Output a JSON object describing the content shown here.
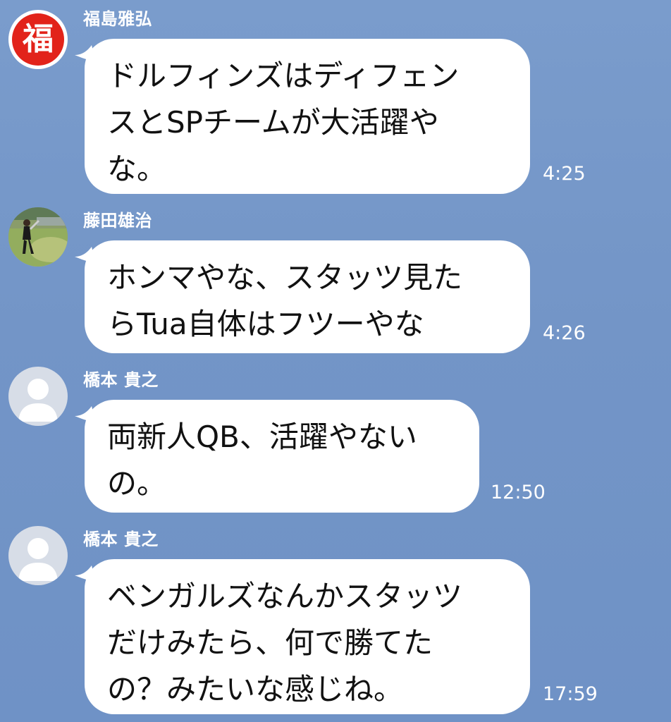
{
  "messages": [
    {
      "sender": "福島雅弘",
      "avatar": "fuku-logo-icon",
      "avatar_text": "福",
      "lines": [
        "ドルフィンズはディフェン",
        "スとSPチームが大活躍や",
        "な。"
      ],
      "time": "4:25"
    },
    {
      "sender": "藤田雄治",
      "avatar": "golfer-photo-icon",
      "lines": [
        "ホンマやな、スタッツ見た",
        "らTua自体はフツーやな"
      ],
      "time": "4:26"
    },
    {
      "sender": "橋本 貴之",
      "avatar": "default-user-icon",
      "lines": [
        "両新人QB、活躍やない",
        "の。"
      ],
      "time": "12:50"
    },
    {
      "sender": "橋本 貴之",
      "avatar": "default-user-icon",
      "lines": [
        "ベンガルズなんかスタッツ",
        "だけみたら、何で勝てた",
        "の？みたいな感じね。"
      ],
      "time": "17:59"
    }
  ],
  "colors": {
    "background": "#7395c7",
    "bubble": "#ffffff",
    "text": "#111111",
    "fuku_red": "#e2231a"
  }
}
